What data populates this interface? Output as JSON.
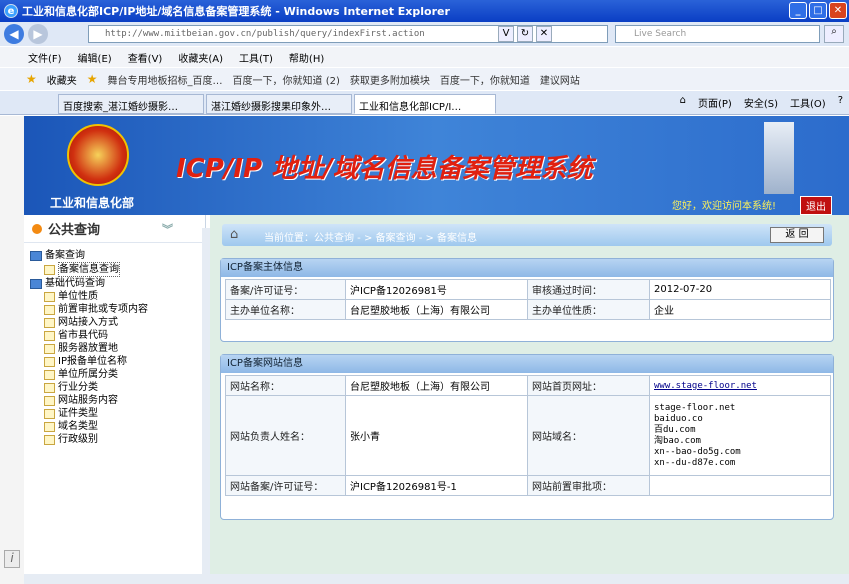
{
  "window": {
    "title": "工业和信息化部ICP/IP地址/域名信息备案管理系统 - Windows Internet Explorer"
  },
  "address": {
    "url": "http://www.miitbeian.gov.cn/publish/query/indexFirst.action",
    "search_placeholder": "Live Search"
  },
  "menu": [
    "文件(F)",
    "编辑(E)",
    "查看(V)",
    "收藏夹(A)",
    "工具(T)",
    "帮助(H)"
  ],
  "favorites": {
    "label": "收藏夹",
    "items": [
      "舞台专用地板招标_百度…",
      "百度一下，你就知道 (2)",
      "获取更多附加模块",
      "百度一下，你就知道",
      "建议网站"
    ]
  },
  "tabs": [
    "百度搜索_湛江婚纱摄影…",
    "湛江婚纱摄影搜果印象外…",
    "工业和信息化部ICP/I…"
  ],
  "commands": [
    "页面(P)",
    "安全(S)",
    "工具(O)"
  ],
  "header": {
    "ministry": "工业和信息化部",
    "system_name": "ICP/IP 地址/域名信息备案管理系统",
    "welcome": "您好，欢迎访问本系统!",
    "exit": "退出"
  },
  "sidebar": {
    "title": "公共查询",
    "groups": [
      {
        "label": "备案查询",
        "items": [
          "备案信息查询"
        ]
      },
      {
        "label": "基础代码查询",
        "items": [
          "单位性质",
          "前置审批或专项内容",
          "网站接入方式",
          "省市县代码",
          "服务器放置地",
          "IP报备单位名称",
          "单位所属分类",
          "行业分类",
          "网站服务内容",
          "证件类型",
          "域名类型",
          "行政级别"
        ]
      }
    ]
  },
  "breadcrumb": {
    "text": "当前位置：公共查询  - >  备案查询  - >  备案信息",
    "back": "返  回"
  },
  "subject": {
    "title": "ICP备案主体信息",
    "license_label": "备案/许可证号：",
    "license": "沪ICP备12026981号",
    "approved_label": "审核通过时间：",
    "approved": "2012-07-20",
    "org_label": "主办单位名称：",
    "org": "台尼塑胶地板（上海）有限公司",
    "nature_label": "主办单位性质：",
    "nature": "企业"
  },
  "site": {
    "title": "ICP备案网站信息",
    "name_label": "网站名称：",
    "name": "台尼塑胶地板（上海）有限公司",
    "home_label": "网站首页网址：",
    "home": "www.stage-floor.net",
    "owner_label": "网站负责人姓名：",
    "owner": "张小青",
    "domain_label": "网站域名：",
    "domains": [
      "stage-floor.net",
      "baiduo.co",
      "百du.com",
      "淘bao.com",
      "xn--bao-do5g.com",
      "xn--du-d87e.com"
    ],
    "license_label": "网站备案/许可证号：",
    "license": "沪ICP备12026981号-1",
    "preapproval_label": "网站前置审批项：",
    "preapproval": ""
  }
}
